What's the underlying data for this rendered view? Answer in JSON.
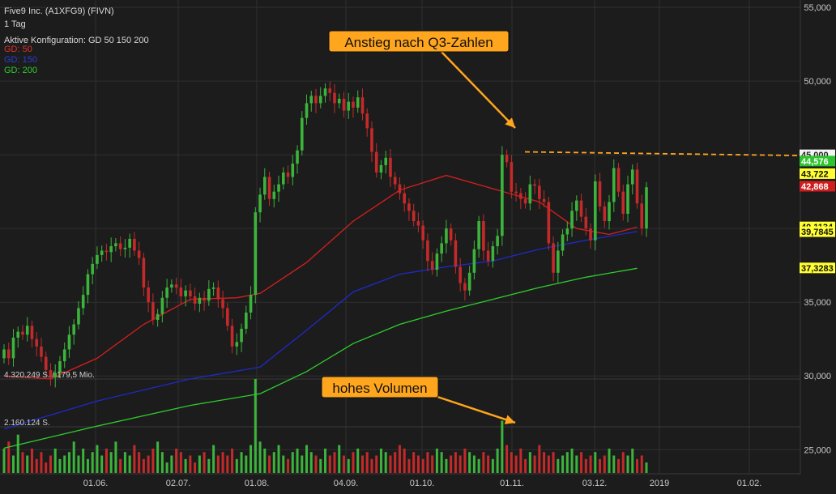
{
  "header": {
    "title": "Five9 Inc. (A1XFG9) (FIVN)",
    "period": "1 Tag",
    "config": "Aktive Konfiguration: GD 50 150 200",
    "legend": [
      {
        "label": "GD: 50",
        "color": "#e03030"
      },
      {
        "label": "GD: 150",
        "color": "#2a3dd8"
      },
      {
        "label": "GD: 200",
        "color": "#2ecc2e"
      }
    ]
  },
  "volume_labels": {
    "max": "4.320.249 S. / 179,5 Mio.",
    "mid": "2.160.124 S."
  },
  "annotations": {
    "q3": "Anstieg nach Q3-Zahlen",
    "volume": "hohes Volumen"
  },
  "chart_data": {
    "type": "candlestick",
    "title": "Five9 Inc. (A1XFG9) (FIVN)",
    "ylim": [
      24300,
      55500
    ],
    "y_ticks": [
      {
        "value": 25000,
        "label": "25,000"
      },
      {
        "value": 30000,
        "label": "30,000"
      },
      {
        "value": 35000,
        "label": "35,000"
      },
      {
        "value": 40000,
        "label": "40,000"
      },
      {
        "value": 45000,
        "label": "45,000"
      },
      {
        "value": 50000,
        "label": "50,000"
      },
      {
        "value": 55000,
        "label": "55,000"
      }
    ],
    "x_ticks": [
      "01.06.",
      "02.07.",
      "01.08.",
      "04.09.",
      "01.10.",
      "01.11.",
      "03.12.",
      "2019",
      "01.02."
    ],
    "price_series": [
      31.8,
      31.2,
      32.6,
      33.0,
      32.8,
      33.4,
      32.5,
      32.0,
      31.3,
      30.4,
      29.9,
      30.2,
      31.0,
      31.8,
      32.8,
      33.5,
      34.6,
      35.5,
      36.9,
      37.6,
      38.2,
      38.5,
      38.4,
      38.8,
      39.0,
      38.6,
      38.7,
      39.3,
      38.5,
      38.0,
      36.0,
      35.0,
      33.8,
      34.2,
      35.3,
      36.0,
      36.2,
      36.0,
      35.4,
      35.8,
      35.4,
      34.9,
      35.3,
      35.1,
      35.9,
      36.0,
      35.2,
      34.6,
      33.4,
      32.0,
      32.3,
      33.2,
      34.3,
      35.5,
      41.1,
      42.3,
      43.5,
      42.0,
      42.5,
      43.0,
      43.8,
      43.5,
      44.4,
      45.3,
      47.5,
      48.5,
      49.0,
      48.5,
      49.0,
      49.5,
      49.2,
      48.5,
      48.8,
      48.0,
      48.6,
      48.2,
      48.9,
      47.8,
      46.8,
      45.2,
      43.8,
      44.3,
      44.8,
      43.5,
      43.0,
      42.4,
      41.7,
      41.2,
      40.5,
      40.2,
      39.2,
      37.8,
      37.2,
      38.3,
      39.0,
      40.0,
      39.2,
      37.4,
      36.3,
      35.8,
      37.0,
      38.6,
      40.5,
      38.5,
      37.8,
      38.8,
      39.5,
      45.0,
      44.5,
      42.5,
      42.4,
      42.0,
      41.7,
      43.0,
      42.9,
      42.0,
      41.8,
      39.0,
      37.0,
      38.5,
      39.6,
      40.0,
      41.2,
      41.9,
      40.8,
      40.0,
      39.2,
      43.2,
      41.5,
      40.5,
      41.8,
      44.1,
      42.5,
      41.0,
      43.0,
      44.0,
      41.7,
      40.0,
      42.8
    ],
    "volume_series": [
      0.7,
      0.9,
      0.5,
      1.1,
      0.6,
      0.5,
      0.7,
      0.4,
      0.6,
      0.3,
      0.5,
      0.7,
      0.4,
      0.5,
      0.6,
      0.9,
      0.5,
      0.7,
      0.4,
      0.6,
      0.8,
      0.5,
      0.7,
      0.6,
      0.9,
      0.4,
      0.6,
      0.5,
      0.8,
      0.6,
      0.4,
      0.5,
      0.7,
      0.9,
      0.6,
      0.3,
      0.5,
      0.7,
      0.6,
      0.4,
      0.5,
      0.3,
      0.5,
      0.6,
      0.4,
      0.8,
      0.5,
      0.6,
      0.5,
      0.7,
      0.4,
      0.6,
      0.5,
      0.8,
      2.7,
      0.9,
      0.7,
      0.5,
      0.6,
      0.8,
      0.5,
      0.4,
      0.6,
      0.7,
      0.5,
      0.8,
      0.6,
      0.5,
      0.4,
      0.7,
      0.5,
      0.6,
      0.8,
      0.5,
      0.4,
      0.6,
      0.7,
      0.5,
      0.6,
      0.4,
      0.5,
      0.7,
      0.6,
      0.5,
      0.6,
      0.8,
      0.7,
      0.4,
      0.6,
      0.5,
      0.4,
      0.6,
      0.5,
      0.7,
      0.6,
      0.4,
      0.5,
      0.6,
      0.5,
      0.7,
      0.6,
      0.5,
      0.4,
      0.6,
      0.5,
      0.4,
      0.7,
      1.5,
      0.8,
      0.6,
      0.5,
      0.7,
      0.4,
      0.6,
      0.5,
      0.8,
      0.6,
      0.5,
      0.6,
      0.4,
      0.5,
      0.6,
      0.7,
      0.5,
      0.6,
      0.4,
      0.5,
      0.6,
      0.4,
      0.5,
      0.7,
      0.5,
      0.4,
      0.6,
      0.5,
      0.7,
      0.4,
      0.5,
      0.3
    ],
    "sma50": [
      {
        "i": 0,
        "v": 30.0
      },
      {
        "i": 10,
        "v": 29.8
      },
      {
        "i": 20,
        "v": 31.2
      },
      {
        "i": 30,
        "v": 33.5
      },
      {
        "i": 40,
        "v": 35.2
      },
      {
        "i": 50,
        "v": 35.3
      },
      {
        "i": 55,
        "v": 35.6
      },
      {
        "i": 65,
        "v": 37.7
      },
      {
        "i": 75,
        "v": 40.5
      },
      {
        "i": 85,
        "v": 42.6
      },
      {
        "i": 95,
        "v": 43.6
      },
      {
        "i": 105,
        "v": 42.7
      },
      {
        "i": 115,
        "v": 41.8
      },
      {
        "i": 123,
        "v": 40.0
      },
      {
        "i": 130,
        "v": 39.6
      },
      {
        "i": 136,
        "v": 40.1
      }
    ],
    "sma150": [
      {
        "i": 0,
        "v": 26.4
      },
      {
        "i": 20,
        "v": 28.3
      },
      {
        "i": 40,
        "v": 29.8
      },
      {
        "i": 55,
        "v": 30.6
      },
      {
        "i": 65,
        "v": 33.1
      },
      {
        "i": 75,
        "v": 35.7
      },
      {
        "i": 85,
        "v": 36.9
      },
      {
        "i": 95,
        "v": 37.4
      },
      {
        "i": 105,
        "v": 37.8
      },
      {
        "i": 115,
        "v": 38.6
      },
      {
        "i": 125,
        "v": 39.2
      },
      {
        "i": 136,
        "v": 39.8
      }
    ],
    "sma200": [
      {
        "i": 0,
        "v": 25.1
      },
      {
        "i": 20,
        "v": 26.6
      },
      {
        "i": 40,
        "v": 28.0
      },
      {
        "i": 55,
        "v": 28.8
      },
      {
        "i": 65,
        "v": 30.3
      },
      {
        "i": 75,
        "v": 32.2
      },
      {
        "i": 85,
        "v": 33.5
      },
      {
        "i": 95,
        "v": 34.4
      },
      {
        "i": 105,
        "v": 35.2
      },
      {
        "i": 115,
        "v": 36.0
      },
      {
        "i": 125,
        "v": 36.7
      },
      {
        "i": 136,
        "v": 37.3
      }
    ],
    "resistance_line": [
      45200,
      44950
    ],
    "price_tags": [
      {
        "text": "45,000",
        "value": 45000,
        "bg": "#f4f4f4",
        "fg": "#222222"
      },
      {
        "text": "44,576",
        "value": 44576,
        "bg": "#2ec42e",
        "fg": "#ffffff"
      },
      {
        "text": "43,722",
        "value": 43722,
        "bg": "#ffff33",
        "fg": "#111111"
      },
      {
        "text": "42,868",
        "value": 42868,
        "bg": "#d01e1e",
        "fg": "#ffffff"
      },
      {
        "text": "40,1134",
        "value": 40110,
        "bg": "#ffff33",
        "fg": "#111111"
      },
      {
        "text": "39,7845",
        "value": 39785,
        "bg": "#ffff33",
        "fg": "#111111"
      },
      {
        "text": "37,3283",
        "value": 37328,
        "bg": "#ffff33",
        "fg": "#111111"
      }
    ],
    "colors": {
      "up": "#3cb43c",
      "down": "#c42a2a",
      "sma50": "#d81e1e",
      "sma150": "#1e2ac8",
      "sma200": "#2ecc2e",
      "annotation": "#ffa51e",
      "background": "#1c1c1c",
      "grid": "#2f2f2f"
    }
  }
}
